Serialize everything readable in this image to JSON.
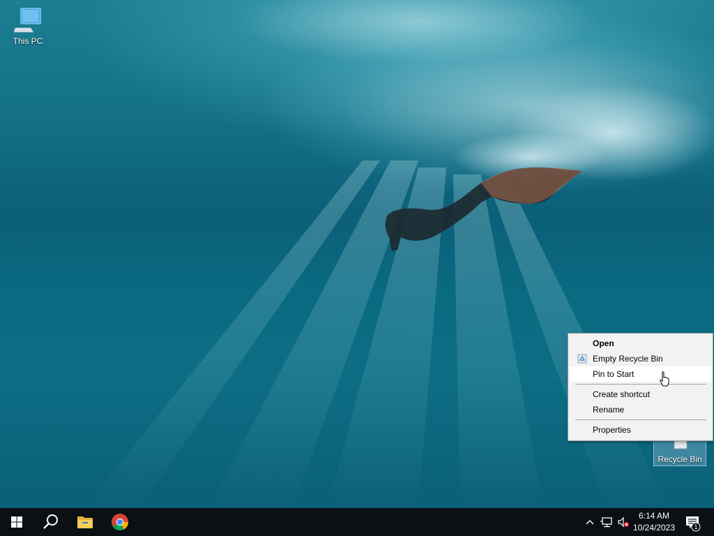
{
  "desktop": {
    "icons": [
      {
        "label": "This PC"
      },
      {
        "label": "Recycle Bin"
      }
    ]
  },
  "context_menu": {
    "items": [
      {
        "label": "Open",
        "bold": true
      },
      {
        "label": "Empty Recycle Bin"
      },
      {
        "label": "Pin to Start",
        "hovered": true
      },
      {
        "label": "Create shortcut"
      },
      {
        "label": "Rename"
      },
      {
        "label": "Properties"
      }
    ]
  },
  "taskbar": {
    "buttons": [
      {
        "icon": "windows-start-icon"
      },
      {
        "icon": "search-icon"
      },
      {
        "icon": "file-explorer-icon"
      },
      {
        "icon": "chrome-icon"
      }
    ],
    "tray": {
      "icons": [
        "chevron-up-icon",
        "network-icon",
        "volume-muted-icon"
      ],
      "time": "6:14 AM",
      "date": "10/24/2023",
      "notification_count": "1"
    }
  },
  "colors": {
    "taskbar": "#0a1014",
    "menu_bg": "#f2f2f2",
    "menu_hover": "#ffffff",
    "accent": "#1e90d6"
  }
}
